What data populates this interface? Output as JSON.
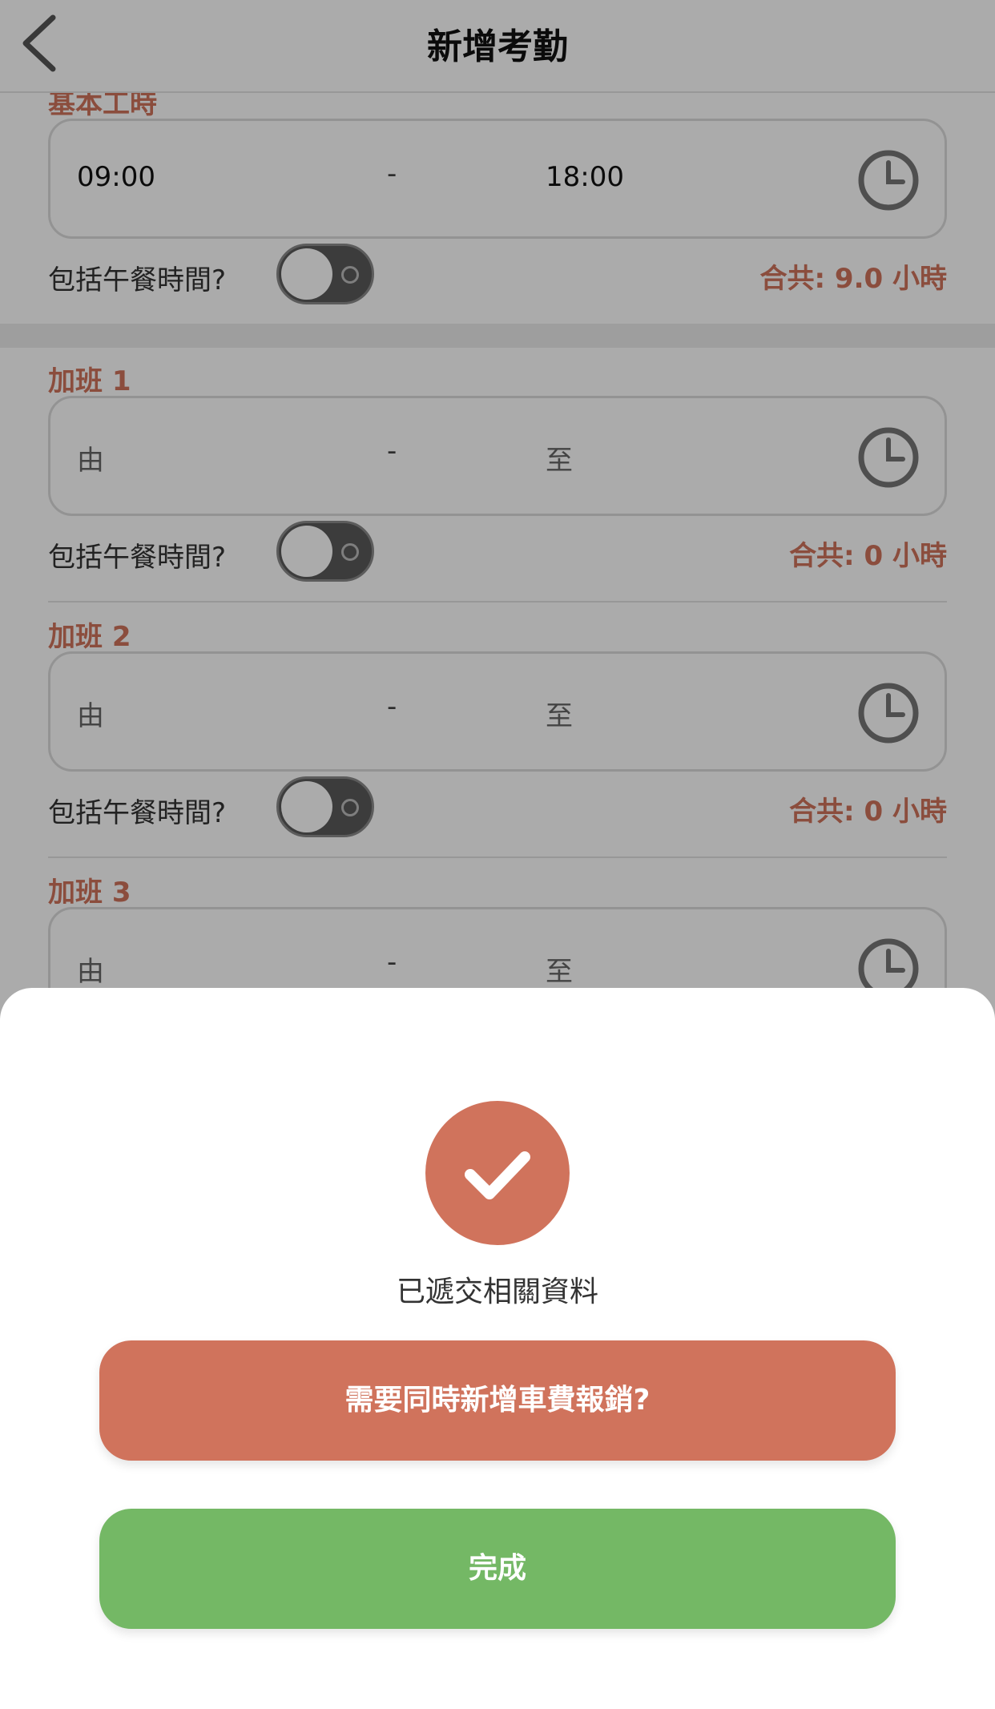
{
  "header": {
    "title": "新增考勤",
    "back_icon": "chevron-left-icon"
  },
  "basic": {
    "label": "基本工時",
    "from": "09:00",
    "to": "18:00",
    "dash": "-",
    "lunch_label": "包括午餐時間?",
    "lunch_on": false,
    "total": "合共: 9.0 小時"
  },
  "overtime": [
    {
      "label": "加班 1",
      "from": "由",
      "to": "至",
      "dash": "-",
      "lunch_label": "包括午餐時間?",
      "lunch_on": false,
      "total": "合共: 0 小時"
    },
    {
      "label": "加班 2",
      "from": "由",
      "to": "至",
      "dash": "-",
      "lunch_label": "包括午餐時間?",
      "lunch_on": false,
      "total": "合共: 0 小時"
    },
    {
      "label": "加班 3",
      "from": "由",
      "to": "至",
      "dash": "-"
    }
  ],
  "sheet": {
    "icon": "checkmark-icon",
    "message": "已遞交相關資料",
    "transport_button": "需要同時新增車費報銷?",
    "done_button": "完成"
  },
  "colors": {
    "accent": "#d0735c",
    "success": "#74b865",
    "toggle_off": "#5a5a5a"
  }
}
